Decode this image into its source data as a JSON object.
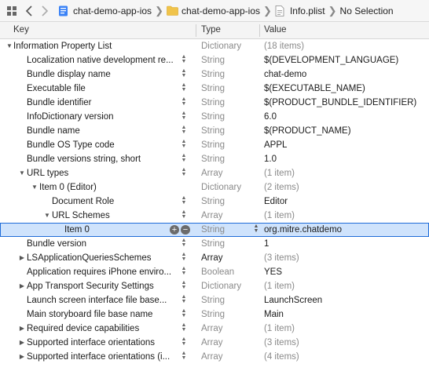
{
  "jumpbar": {
    "crumbs": [
      "chat-demo-app-ios",
      "chat-demo-app-ios",
      "Info.plist",
      "No Selection"
    ]
  },
  "header": {
    "key": "Key",
    "type": "Type",
    "value": "Value"
  },
  "rows": [
    {
      "key": "Information Property List",
      "type": "Dictionary",
      "value": "(18 items)",
      "level": 0,
      "disc": "open",
      "stepper": false,
      "typeDark": false,
      "valMuted": true
    },
    {
      "key": "Localization native development re...",
      "type": "String",
      "value": "$(DEVELOPMENT_LANGUAGE)",
      "level": 1,
      "disc": "none",
      "stepper": true,
      "typeDark": false,
      "valMuted": false
    },
    {
      "key": "Bundle display name",
      "type": "String",
      "value": "chat-demo",
      "level": 1,
      "disc": "none",
      "stepper": true,
      "typeDark": false,
      "valMuted": false
    },
    {
      "key": "Executable file",
      "type": "String",
      "value": "$(EXECUTABLE_NAME)",
      "level": 1,
      "disc": "none",
      "stepper": true,
      "typeDark": false,
      "valMuted": false
    },
    {
      "key": "Bundle identifier",
      "type": "String",
      "value": "$(PRODUCT_BUNDLE_IDENTIFIER)",
      "level": 1,
      "disc": "none",
      "stepper": true,
      "typeDark": false,
      "valMuted": false
    },
    {
      "key": "InfoDictionary version",
      "type": "String",
      "value": "6.0",
      "level": 1,
      "disc": "none",
      "stepper": true,
      "typeDark": false,
      "valMuted": false
    },
    {
      "key": "Bundle name",
      "type": "String",
      "value": "$(PRODUCT_NAME)",
      "level": 1,
      "disc": "none",
      "stepper": true,
      "typeDark": false,
      "valMuted": false
    },
    {
      "key": "Bundle OS Type code",
      "type": "String",
      "value": "APPL",
      "level": 1,
      "disc": "none",
      "stepper": true,
      "typeDark": false,
      "valMuted": false
    },
    {
      "key": "Bundle versions string, short",
      "type": "String",
      "value": "1.0",
      "level": 1,
      "disc": "none",
      "stepper": true,
      "typeDark": false,
      "valMuted": false
    },
    {
      "key": "URL types",
      "type": "Array",
      "value": "(1 item)",
      "level": 1,
      "disc": "open",
      "stepper": true,
      "typeDark": false,
      "valMuted": true
    },
    {
      "key": "Item 0 (Editor)",
      "type": "Dictionary",
      "value": "(2 items)",
      "level": 2,
      "disc": "open",
      "stepper": false,
      "typeDark": false,
      "valMuted": true
    },
    {
      "key": "Document Role",
      "type": "String",
      "value": "Editor",
      "level": 3,
      "disc": "none",
      "stepper": true,
      "typeDark": false,
      "valMuted": false
    },
    {
      "key": "URL Schemes",
      "type": "Array",
      "value": "(1 item)",
      "level": 3,
      "disc": "open",
      "stepper": true,
      "typeDark": false,
      "valMuted": true
    },
    {
      "key": "Item 0",
      "type": "String",
      "value": "org.mitre.chatdemo",
      "level": 4,
      "disc": "none",
      "stepper": false,
      "typeDark": false,
      "valMuted": false,
      "selected": true
    },
    {
      "key": "Bundle version",
      "type": "String",
      "value": "1",
      "level": 1,
      "disc": "none",
      "stepper": true,
      "typeDark": false,
      "valMuted": false
    },
    {
      "key": "LSApplicationQueriesSchemes",
      "type": "Array",
      "value": "(3 items)",
      "level": 1,
      "disc": "closed",
      "stepper": true,
      "typeDark": true,
      "valMuted": true
    },
    {
      "key": "Application requires iPhone enviro...",
      "type": "Boolean",
      "value": "YES",
      "level": 1,
      "disc": "none",
      "stepper": true,
      "typeDark": false,
      "valMuted": false
    },
    {
      "key": "App Transport Security Settings",
      "type": "Dictionary",
      "value": "(1 item)",
      "level": 1,
      "disc": "closed",
      "stepper": true,
      "typeDark": false,
      "valMuted": true
    },
    {
      "key": "Launch screen interface file base...",
      "type": "String",
      "value": "LaunchScreen",
      "level": 1,
      "disc": "none",
      "stepper": true,
      "typeDark": false,
      "valMuted": false
    },
    {
      "key": "Main storyboard file base name",
      "type": "String",
      "value": "Main",
      "level": 1,
      "disc": "none",
      "stepper": true,
      "typeDark": false,
      "valMuted": false
    },
    {
      "key": "Required device capabilities",
      "type": "Array",
      "value": "(1 item)",
      "level": 1,
      "disc": "closed",
      "stepper": true,
      "typeDark": false,
      "valMuted": true
    },
    {
      "key": "Supported interface orientations",
      "type": "Array",
      "value": "(3 items)",
      "level": 1,
      "disc": "closed",
      "stepper": true,
      "typeDark": false,
      "valMuted": true
    },
    {
      "key": "Supported interface orientations (i...",
      "type": "Array",
      "value": "(4 items)",
      "level": 1,
      "disc": "closed",
      "stepper": true,
      "typeDark": false,
      "valMuted": true
    }
  ],
  "colors": {
    "selection": "#cfe3fc",
    "selection_border": "#1f6cd8",
    "muted": "#8a8a8a"
  }
}
